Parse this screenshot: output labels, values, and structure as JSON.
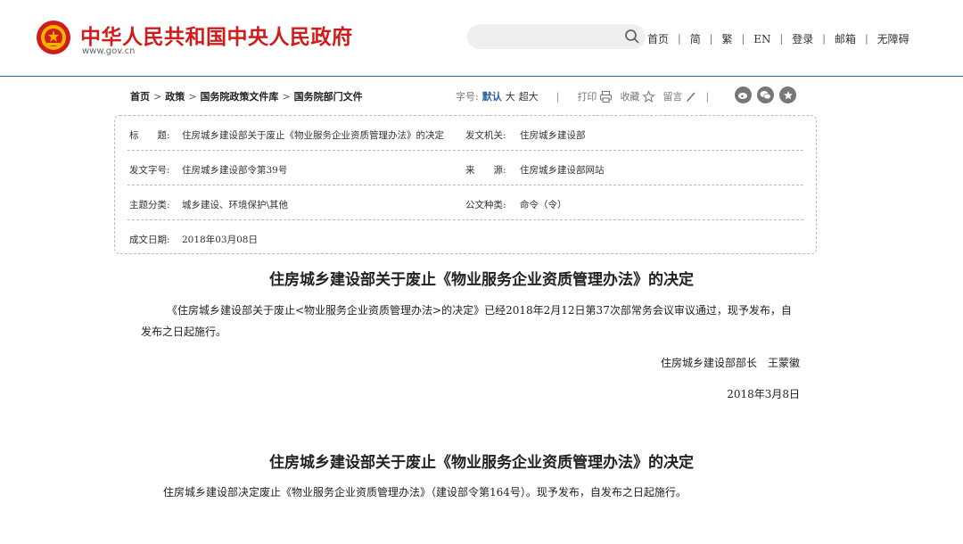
{
  "header": {
    "site_name": "中华人民共和国中央人民政府",
    "site_url": "www.gov.cn",
    "search": {
      "placeholder": ""
    },
    "nav": [
      "首页",
      "简",
      "繁",
      "EN",
      "登录",
      "邮箱",
      "无障碍"
    ]
  },
  "breadcrumb": {
    "items": [
      "首页",
      "政策",
      "国务院政策文件库",
      "国务院部门文件"
    ]
  },
  "tools": {
    "font_size_label": "字号:",
    "font_default": "默认",
    "font_large": "大",
    "font_xlarge": "超大",
    "print": "打印",
    "favorite": "收藏",
    "comment": "留言"
  },
  "info": {
    "title_label": "标　　题:",
    "title_value": "住房城乡建设部关于废止《物业服务企业资质管理办法》的决定",
    "issuer_label": "发文机关:",
    "issuer_value": "住房城乡建设部",
    "docno_label": "发文字号:",
    "docno_value": "住房城乡建设部令第39号",
    "source_label": "来　　源:",
    "source_value": "住房城乡建设部网站",
    "topic_label": "主题分类:",
    "topic_value": "城乡建设、环境保护\\其他",
    "type_label": "公文种类:",
    "type_value": "命令（令）",
    "date_label": "成文日期:",
    "date_value": "2018年03月08日"
  },
  "article1": {
    "title": "住房城乡建设部关于废止《物业服务企业资质管理办法》的决定",
    "body_line1": "《住房城乡建设部关于废止<物业服务企业资质管理办法>的决定》已经2018年2月12日第37次部常务会议审议通过，现予发布，自",
    "body_line2": "发布之日起施行。",
    "signature": "住房城乡建设部部长　王蒙徽",
    "date": "2018年3月8日"
  },
  "article2": {
    "title": "住房城乡建设部关于废止《物业服务企业资质管理办法》的决定",
    "body": "住房城乡建设部决定废止《物业服务企业资质管理办法》（建设部令第164号）。现予发布，自发布之日起施行。"
  },
  "colors": {
    "brand_red": "#d11c1c",
    "link_blue": "#2a5ea8",
    "header_border": "#2b6ca8"
  }
}
